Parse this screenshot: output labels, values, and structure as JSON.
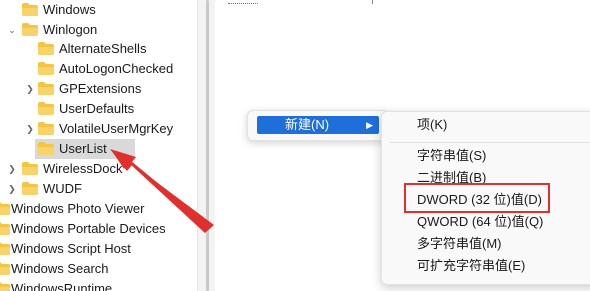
{
  "tree": {
    "items": [
      {
        "label": "Windows",
        "chevron": "",
        "depth": 1
      },
      {
        "label": "Winlogon",
        "chevron": "expanded",
        "depth": 1
      },
      {
        "label": "AlternateShells",
        "chevron": "",
        "depth": 2
      },
      {
        "label": "AutoLogonChecked",
        "chevron": "",
        "depth": 2
      },
      {
        "label": "GPExtensions",
        "chevron": "collapsed",
        "depth": 2
      },
      {
        "label": "UserDefaults",
        "chevron": "",
        "depth": 2
      },
      {
        "label": "VolatileUserMgrKey",
        "chevron": "collapsed",
        "depth": 2
      },
      {
        "label": "UserList",
        "chevron": "",
        "depth": 2,
        "selected": true
      },
      {
        "label": "WirelessDock",
        "chevron": "collapsed",
        "depth": 1
      },
      {
        "label": "WUDF",
        "chevron": "collapsed",
        "depth": 1
      },
      {
        "label": "Windows Photo Viewer",
        "chevron": "",
        "depth": 0
      },
      {
        "label": "Windows Portable Devices",
        "chevron": "",
        "depth": 0
      },
      {
        "label": "Windows Script Host",
        "chevron": "",
        "depth": 0
      },
      {
        "label": "Windows Search",
        "chevron": "",
        "depth": 0
      },
      {
        "label": "WindowsRuntime",
        "chevron": "",
        "depth": 0
      }
    ]
  },
  "context_menu": {
    "new_label": "新建(N)",
    "submenu": {
      "key": "项(K)",
      "string_value": "字符串值(S)",
      "binary_value": "二进制值(B)",
      "dword_value": "DWORD (32 位)值(D)",
      "qword_value": "QWORD (64 位)值(Q)",
      "multi_string_value": "多字符串值(M)",
      "expandable_string_value": "可扩充字符串值(E)"
    }
  },
  "colors": {
    "highlight": "#1e6fd9",
    "annotation": "#e0302e",
    "folder": "#f5c542"
  },
  "icons": {
    "folder": "folder-icon",
    "chevron_right": "chevron-right-icon",
    "chevron_down": "chevron-down-icon"
  }
}
